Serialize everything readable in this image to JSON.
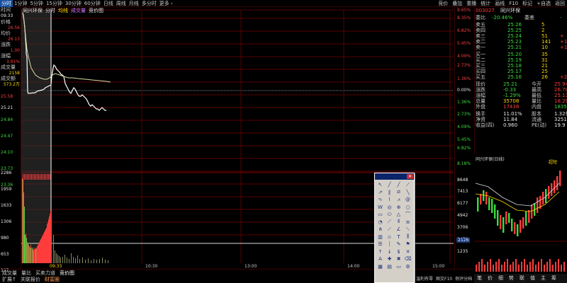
{
  "top_tabs": [
    "分时",
    "1分钟",
    "5分钟",
    "15分钟",
    "30分钟",
    "60分钟",
    "日线",
    "周线",
    "月线",
    "多分时",
    "更多 ›"
  ],
  "top_menu": [
    "竞价",
    "叠加",
    "重播",
    "统计",
    "画线",
    "F10",
    "标记",
    "+自选",
    "返回"
  ],
  "top_right_pct": "9.65%",
  "subheader": {
    "name": "同兴环保",
    "tab1": "分时",
    "tab2": "均线",
    "tab3": "成交量",
    "tab4": "竞价图"
  },
  "left_panel": {
    "time_label": "时间",
    "time_val": "09:33",
    "price_label": "价格",
    "price_val": "26.56",
    "avg_label": "均价",
    "avg_val": "26.13",
    "chg_label": "涨跌",
    "chg_val": "1.00",
    "pct_label": "涨幅",
    "pct_val": "3.91%",
    "vol_label": "成交量",
    "vol_val": "2158",
    "amt_label": "成交额",
    "amt_val": "573.2万"
  },
  "price_axis_left": [
    "25.58",
    "25.21",
    "24.84",
    "24.47",
    "24.10",
    "23.73",
    "23.36"
  ],
  "price_axis_right": [
    "8.35%",
    "6.82%",
    "5.45%",
    "4.09%",
    "2.73%",
    "1.36%",
    "0.00%",
    "1.36%",
    "2.73%",
    "4.09%",
    "5.45%",
    "6.82%",
    "8.18%"
  ],
  "vol_axis_left": [
    "2286",
    "1959",
    "1633",
    "1306",
    "980",
    "653",
    "327"
  ],
  "vol_axis_right": [
    "8648",
    "7413",
    "6177",
    "4942",
    "3706",
    "2471",
    "1235"
  ],
  "highlight_label": "2126",
  "time_axis": [
    "09:33",
    "10:30",
    "13:00",
    "14:00",
    "15:00"
  ],
  "quote": {
    "stock_code": "003027",
    "stock_name": "同兴环保",
    "wb_label": "委比",
    "wb_val": "-20.46%",
    "wc_label": "委差",
    "wc_val": "-",
    "sells": [
      {
        "label": "卖五",
        "price": "25.26",
        "vol": "5",
        "chg": ""
      },
      {
        "label": "卖四",
        "price": "25.25",
        "vol": "2",
        "chg": ""
      },
      {
        "label": "卖三",
        "price": "25.24",
        "vol": "51",
        "chg": "+"
      },
      {
        "label": "卖二",
        "price": "25.23",
        "vol": "141",
        "chg": "+1"
      },
      {
        "label": "卖一",
        "price": "25.21",
        "vol": "10",
        "chg": "+1"
      }
    ],
    "buys": [
      {
        "label": "买一",
        "price": "25.20",
        "vol": "35",
        "chg": ""
      },
      {
        "label": "买二",
        "price": "25.19",
        "vol": "31",
        "chg": ""
      },
      {
        "label": "买三",
        "price": "25.18",
        "vol": "21",
        "chg": ""
      },
      {
        "label": "买四",
        "price": "25.17",
        "vol": "25",
        "chg": ""
      },
      {
        "label": "买五",
        "price": "25.16",
        "vol": "26",
        "chg": "+2"
      }
    ],
    "stats": [
      {
        "l1": "现价",
        "v1": "25.21",
        "l2": "今开",
        "v2": "25.94"
      },
      {
        "l1": "涨跌",
        "v1": "-0.33",
        "l2": "最高",
        "v2": "26.70"
      },
      {
        "l1": "涨幅",
        "v1": "-1.29%",
        "l2": "最低",
        "v2": "25.13"
      },
      {
        "l1": "总量",
        "v1": "35708",
        "l2": "量比",
        "v2": "18.29"
      },
      {
        "l1": "外盘",
        "v1": "17438",
        "l2": "内盘",
        "v2": "18350"
      }
    ],
    "stats2": [
      {
        "l1": "换手",
        "v1": "11.01%",
        "l2": "股本",
        "v2": "1.32亿"
      },
      {
        "l1": "净资",
        "v1": "11.84",
        "l2": "流通",
        "v2": "3251万"
      },
      {
        "l1": "收益(四)",
        "v1": "0.960",
        "l2": "PE(动)",
        "v2": "19.9"
      }
    ]
  },
  "mini": {
    "title": "同兴环保(日线)",
    "tag": "超短"
  },
  "bottom_tabs1": [
    "成交量",
    "量比",
    "买卖力道",
    "竞价图"
  ],
  "bottom_tabs2": [
    "扩展↑",
    "关联报价",
    "财富圈"
  ],
  "bottom_right": [
    "笔",
    "价",
    "细",
    "势",
    "联",
    "值",
    "主",
    "筹"
  ],
  "ticker": [
    "温利有零",
    "图交F10",
    "例评分档"
  ],
  "toolbox_tools": [
    "pointer",
    "line",
    "ray",
    "segment",
    "arrow-line",
    "parallel",
    "channel",
    "trend",
    "wave",
    "polyline",
    "fan",
    "spiral",
    "w-shape",
    "cycle",
    "gann",
    "circle",
    "rect",
    "ellipse",
    "triangle",
    "arc",
    "fib-arc",
    "fib-fan",
    "fib-time",
    "fib-ret",
    "pitchfork",
    "speed",
    "angle",
    "regression",
    "bars",
    "gap",
    "text",
    "vlines",
    "hlines",
    "period",
    "note",
    "flag",
    "up-arrow",
    "down-arrow",
    "price-label",
    "mark",
    "text-a",
    "cross",
    "delete",
    "clear",
    "grid",
    "lock",
    "save",
    "settings"
  ],
  "colors": {
    "up": "#ff3c3c",
    "down": "#3cdc3c",
    "bg": "#000000",
    "grid": "#5a0000"
  }
}
